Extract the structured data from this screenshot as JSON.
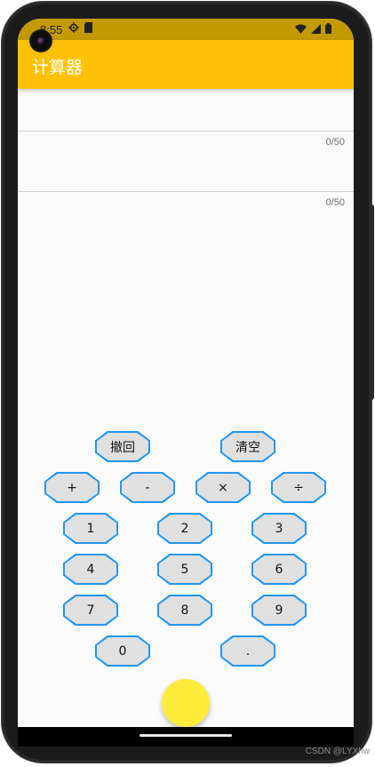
{
  "status_bar": {
    "time": "8:55",
    "icons": [
      "settings-gear-icon",
      "sd-card-icon",
      "wifi-icon",
      "cellular-signal-icon",
      "battery-icon"
    ]
  },
  "app_bar": {
    "title": "计算器",
    "color": "#ffc107"
  },
  "fields": {
    "expression": {
      "value": "",
      "counter": "0/50"
    },
    "result": {
      "value": "",
      "counter": "0/50"
    }
  },
  "keypad": {
    "undo": "撤回",
    "clear": "清空",
    "plus": "+",
    "minus": "-",
    "multiply": "×",
    "divide": "÷",
    "digits": [
      "0",
      "1",
      "2",
      "3",
      "4",
      "5",
      "6",
      "7",
      "8",
      "9"
    ],
    "dot": ".",
    "button_fill": "#e0e0e0",
    "button_border": "#2196f3"
  },
  "fab": {
    "color": "#ffeb3b"
  },
  "watermark": "CSDN @LYXhw"
}
